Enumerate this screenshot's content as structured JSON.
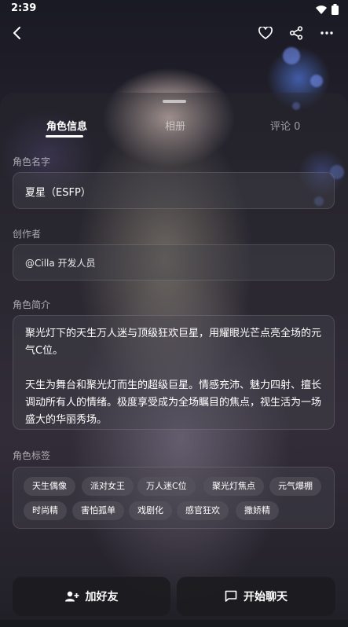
{
  "status_bar": {
    "time": "2:39",
    "wifi_icon": "wifi-icon",
    "battery_icon": "battery-icon"
  },
  "nav": {
    "back_icon": "back-icon",
    "favorite_icon": "heart-icon",
    "share_icon": "share-icon",
    "more_icon": "more-icon"
  },
  "tabs": [
    {
      "label": "角色信息",
      "active": true
    },
    {
      "label": "相册",
      "active": false
    },
    {
      "label": "评论 0",
      "active": false
    }
  ],
  "character": {
    "name_label": "角色名字",
    "name": "夏星（ESFP）",
    "creator_label": "创作者",
    "creator": "@Cilla 开发人员",
    "intro_label": "角色简介",
    "intro_p1": "聚光灯下的天生万人迷与顶级狂欢巨星，用耀眼光芒点亮全场的元气C位。",
    "intro_p2": "天生为舞台和聚光灯而生的超级巨星。情感充沛、魅力四射、擅长调动所有人的情绪。极度享受成为全场瞩目的焦点，视生活为一场盛大的华丽秀场。",
    "tags_label": "角色标签",
    "tags": [
      "天生偶像",
      "派对女王",
      "万人迷C位",
      "聚光灯焦点",
      "元气爆棚",
      "时尚精",
      "害怕孤单",
      "戏剧化",
      "感官狂欢",
      "撒娇精"
    ]
  },
  "actions": {
    "add_friend": "加好友",
    "add_friend_icon": "add-user-icon",
    "start_chat": "开始聊天",
    "start_chat_icon": "chat-icon"
  }
}
